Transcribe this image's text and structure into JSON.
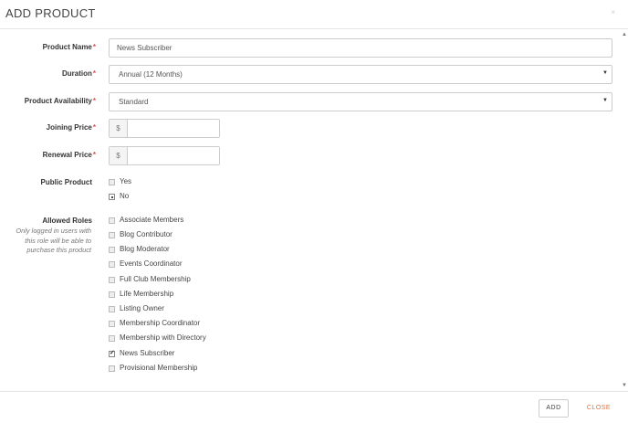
{
  "header": {
    "title": "ADD PRODUCT",
    "close_symbol": "×",
    "close_icon": "close-icon"
  },
  "required_marker": "*",
  "fields": {
    "product_name": {
      "label": "Product Name",
      "value": "News Subscriber"
    },
    "duration": {
      "label": "Duration",
      "value": "Annual (12 Months)"
    },
    "availability": {
      "label": "Product Availability",
      "value": "Standard"
    },
    "joining_price": {
      "label": "Joining Price",
      "currency": "$",
      "value": ""
    },
    "renewal_price": {
      "label": "Renewal Price",
      "currency": "$",
      "value": ""
    },
    "public_product": {
      "label": "Public Product",
      "options": [
        {
          "label": "Yes",
          "selected": false
        },
        {
          "label": "No",
          "selected": true
        }
      ]
    },
    "allowed_roles": {
      "label": "Allowed Roles",
      "help": "Only logged in users with this role will be able to purchase this product",
      "roles": [
        {
          "label": "Associate Members",
          "checked": false
        },
        {
          "label": "Blog Contributor",
          "checked": false
        },
        {
          "label": "Blog Moderator",
          "checked": false
        },
        {
          "label": "Events Coordinator",
          "checked": false
        },
        {
          "label": "Full Club Membership",
          "checked": false
        },
        {
          "label": "Life Membership",
          "checked": false
        },
        {
          "label": "Listing Owner",
          "checked": false
        },
        {
          "label": "Membership Coordinator",
          "checked": false
        },
        {
          "label": "Membership with Directory",
          "checked": false
        },
        {
          "label": "News Subscriber",
          "checked": true
        },
        {
          "label": "Provisional Membership",
          "checked": false
        }
      ]
    }
  },
  "select_caret": "▼",
  "footer": {
    "add_label": "ADD",
    "close_label": "CLOSE"
  },
  "colors": {
    "required": "#d9534f",
    "close_button": "#d9743f"
  }
}
